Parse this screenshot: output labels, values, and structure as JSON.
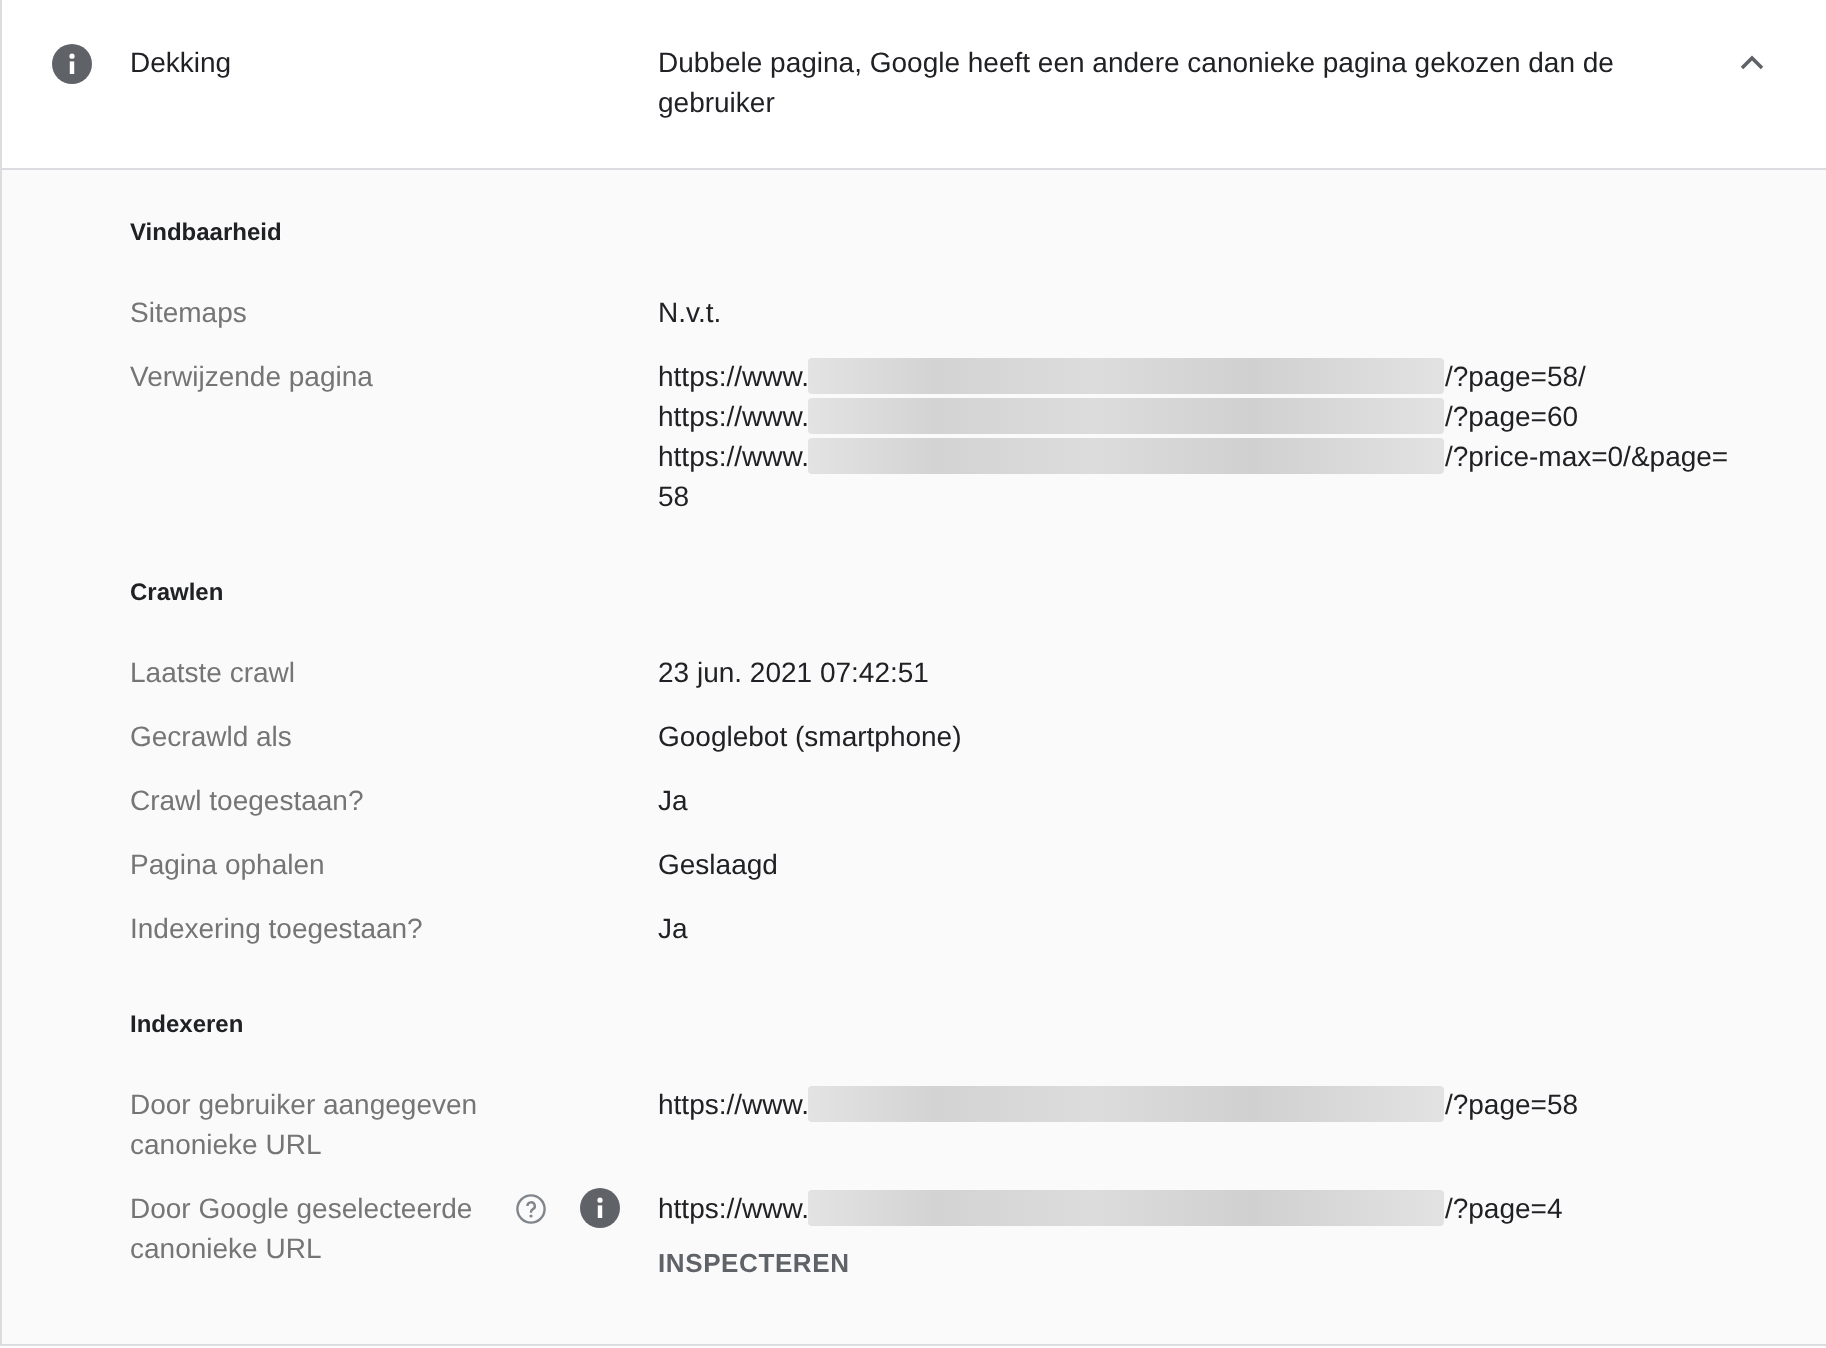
{
  "header": {
    "label": "Dekking",
    "value": "Dubbele pagina, Google heeft een andere canonieke pagina gekozen dan de gebruiker",
    "expanded": true
  },
  "sections": [
    {
      "title": "Vindbaarheid",
      "rows": [
        {
          "kind": "text",
          "label": "Sitemaps",
          "value": "N.v.t."
        },
        {
          "kind": "urls",
          "label": "Verwijzende pagina",
          "urls": [
            {
              "start": "https://www.",
              "redacted": true,
              "end": "/?page=58/"
            },
            {
              "start": "https://www.",
              "redacted": true,
              "end": "/?page=60"
            },
            {
              "start": "https://www.",
              "redacted": true,
              "end": "/?price-max=0/&page=58"
            }
          ]
        }
      ]
    },
    {
      "title": "Crawlen",
      "rows": [
        {
          "kind": "text",
          "label": "Laatste crawl",
          "value": "23 jun. 2021 07:42:51"
        },
        {
          "kind": "text",
          "label": "Gecrawld als",
          "value": "Googlebot (smartphone)"
        },
        {
          "kind": "text",
          "label": "Crawl toegestaan?",
          "value": "Ja"
        },
        {
          "kind": "text",
          "label": "Pagina ophalen",
          "value": "Geslaagd"
        },
        {
          "kind": "text",
          "label": "Indexering toegestaan?",
          "value": "Ja"
        }
      ]
    },
    {
      "title": "Indexeren",
      "rows": [
        {
          "kind": "urls",
          "label": "Door gebruiker aangegeven canonieke URL",
          "urls": [
            {
              "start": "https://www.",
              "redacted": true,
              "end": "/?page=58"
            }
          ]
        },
        {
          "kind": "urls",
          "label": "Door Google geselecteerde canonieke URL",
          "help": true,
          "info": true,
          "urls": [
            {
              "start": "https://www.",
              "redacted": true,
              "end": "/?page=4"
            }
          ],
          "action": "INSPECTEREN"
        }
      ]
    }
  ]
}
